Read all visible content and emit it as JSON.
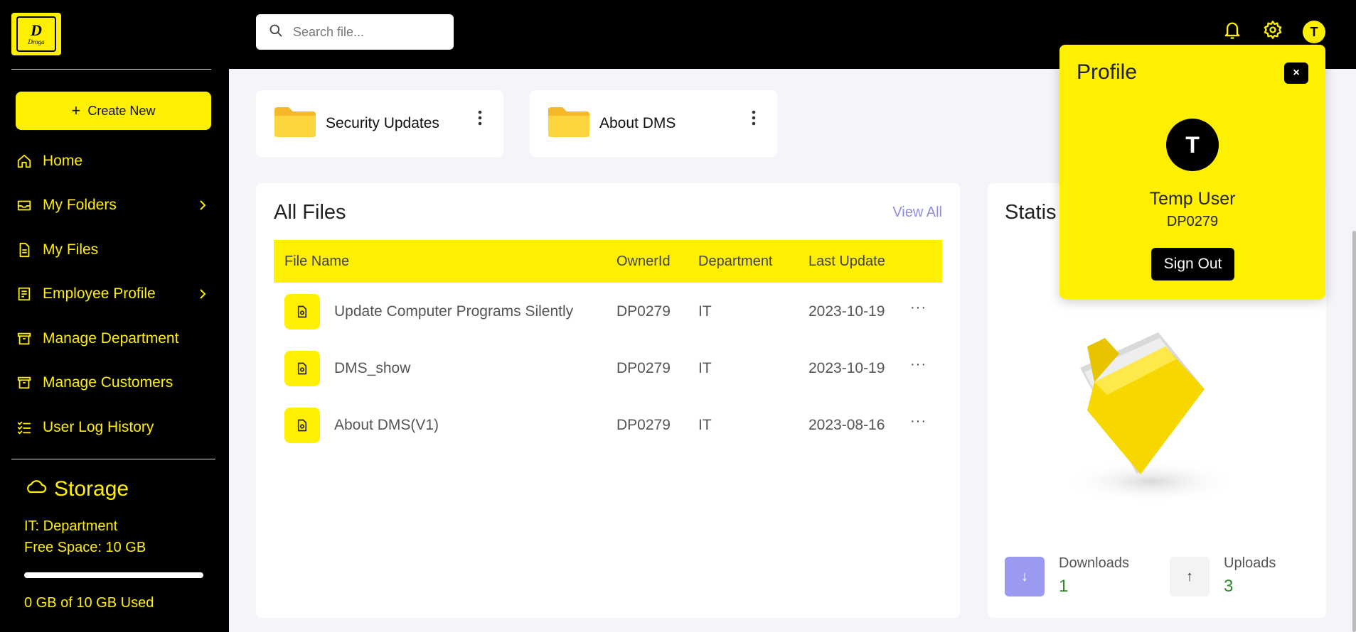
{
  "app": {
    "logo_letter": "D",
    "logo_word": "Droga"
  },
  "sidebar": {
    "create_label": "Create New",
    "items": [
      {
        "label": "Home",
        "icon": "home-icon",
        "has_chevron": false
      },
      {
        "label": "My Folders",
        "icon": "folder-outline-icon",
        "has_chevron": true
      },
      {
        "label": "My Files",
        "icon": "file-icon",
        "has_chevron": false
      },
      {
        "label": "Employee Profile",
        "icon": "profile-card-icon",
        "has_chevron": true
      },
      {
        "label": "Manage Department",
        "icon": "archive-icon",
        "has_chevron": false
      },
      {
        "label": "Manage Customers",
        "icon": "archive-icon",
        "has_chevron": false
      },
      {
        "label": "User Log History",
        "icon": "list-check-icon",
        "has_chevron": false
      }
    ],
    "storage": {
      "title": "Storage",
      "department": "IT: Department",
      "free_space": "Free Space: 10 GB",
      "used_text": "0 GB of 10 GB Used",
      "used_fraction": 0
    }
  },
  "header": {
    "search_placeholder": "Search file...",
    "avatar_initial": "T"
  },
  "folders": [
    {
      "name": "Security Updates"
    },
    {
      "name": "About DMS"
    }
  ],
  "files": {
    "title": "All Files",
    "view_all": "View All",
    "columns": [
      "File Name",
      "OwnerId",
      "Department",
      "Last Update"
    ],
    "rows": [
      {
        "name": "Update Computer Programs Silently",
        "owner": "DP0279",
        "department": "IT",
        "updated": "2023-10-19"
      },
      {
        "name": "DMS_show",
        "owner": "DP0279",
        "department": "IT",
        "updated": "2023-10-19"
      },
      {
        "name": "About DMS(V1)",
        "owner": "DP0279",
        "department": "IT",
        "updated": "2023-08-16"
      }
    ]
  },
  "stats": {
    "title": "Statis",
    "downloads_label": "Downloads",
    "downloads_value": "1",
    "uploads_label": "Uploads",
    "uploads_value": "3"
  },
  "profile": {
    "title": "Profile",
    "close": "×",
    "initial": "T",
    "name": "Temp User",
    "id": "DP0279",
    "sign_out": "Sign Out"
  },
  "colors": {
    "accent": "#ffef00",
    "dark": "#000000",
    "link": "#8d8de0",
    "stat_value": "#2a8a2a",
    "download_box": "#9a9af0"
  }
}
